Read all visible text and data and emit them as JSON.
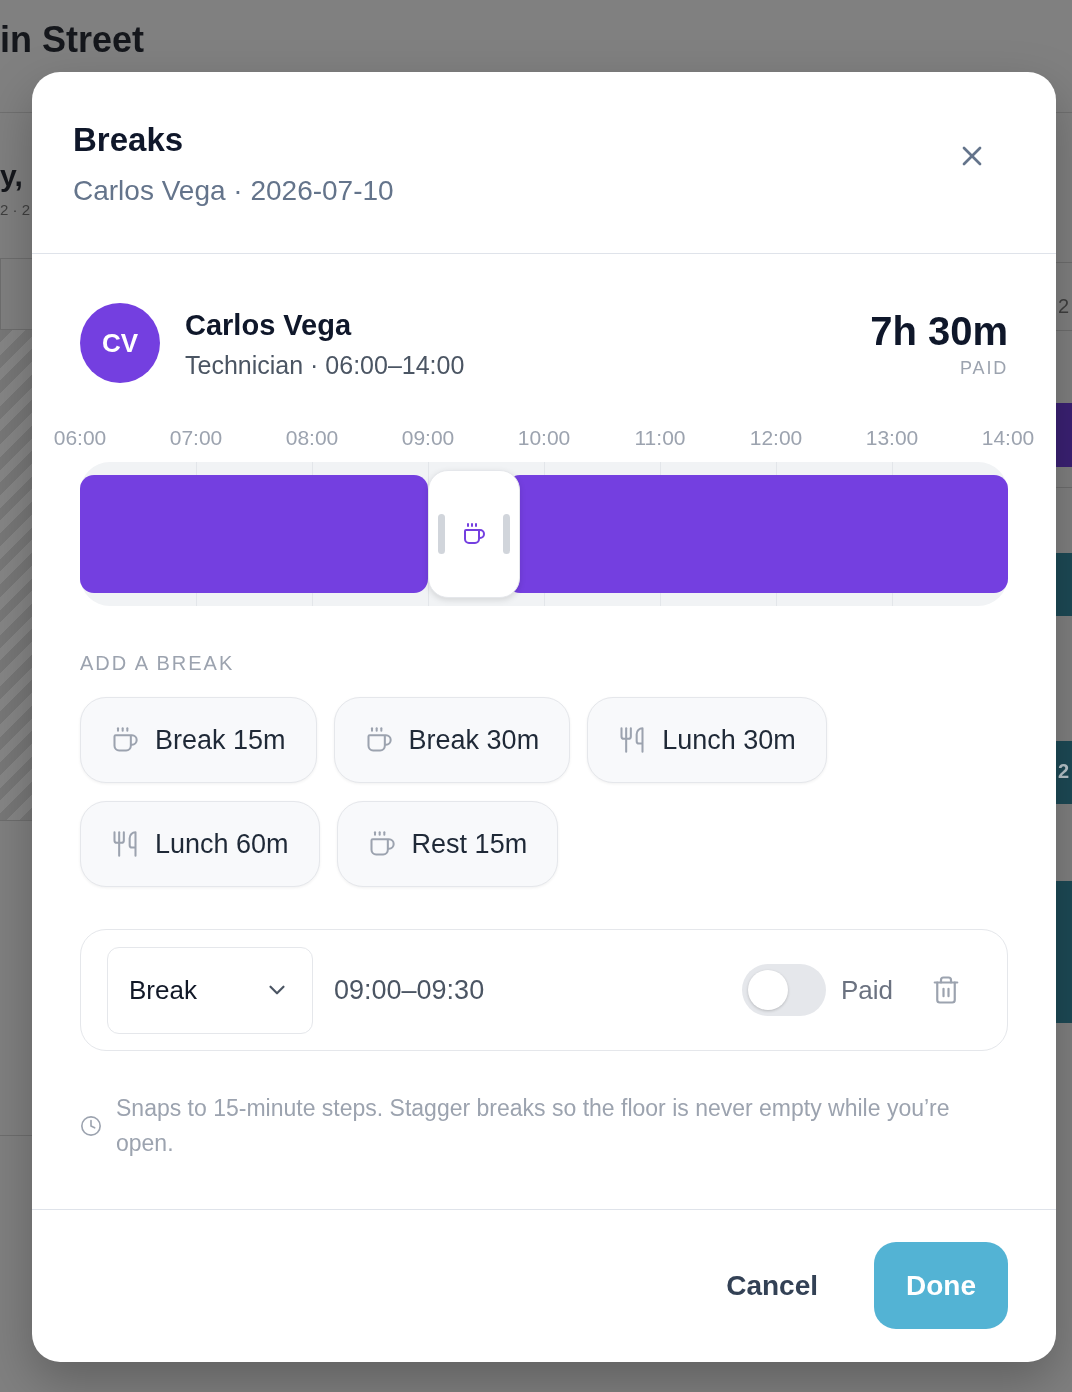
{
  "backdrop": {
    "title": "in Street",
    "day": "y,",
    "day_meta": "2 · 2",
    "side_count": "2",
    "block_label": "2"
  },
  "dialog": {
    "title": "Breaks",
    "subtitle": "Carlos Vega · 2026-07-10"
  },
  "employee": {
    "initials": "CV",
    "name": "Carlos Vega",
    "role_hours": "Technician · 06:00–14:00",
    "paid_total": "7h 30m",
    "paid_label": "PAID"
  },
  "timeline": {
    "hours": [
      "06:00",
      "07:00",
      "08:00",
      "09:00",
      "10:00",
      "11:00",
      "12:00",
      "13:00",
      "14:00"
    ]
  },
  "add_break": {
    "label": "ADD A BREAK",
    "presets": [
      {
        "kind": "break",
        "label": "Break 15m"
      },
      {
        "kind": "break",
        "label": "Break 30m"
      },
      {
        "kind": "meal",
        "label": "Lunch 30m"
      },
      {
        "kind": "meal",
        "label": "Lunch 60m"
      },
      {
        "kind": "break",
        "label": "Rest 15m"
      }
    ]
  },
  "breaks": [
    {
      "kind": "break",
      "type": "Break",
      "time": "09:00–09:30",
      "paid": false,
      "paid_label": "Paid"
    }
  ],
  "note": "Snaps to 15-minute steps. Stagger breaks so the floor is never empty while you’re open.",
  "footer": {
    "cancel": "Cancel",
    "done": "Done"
  }
}
